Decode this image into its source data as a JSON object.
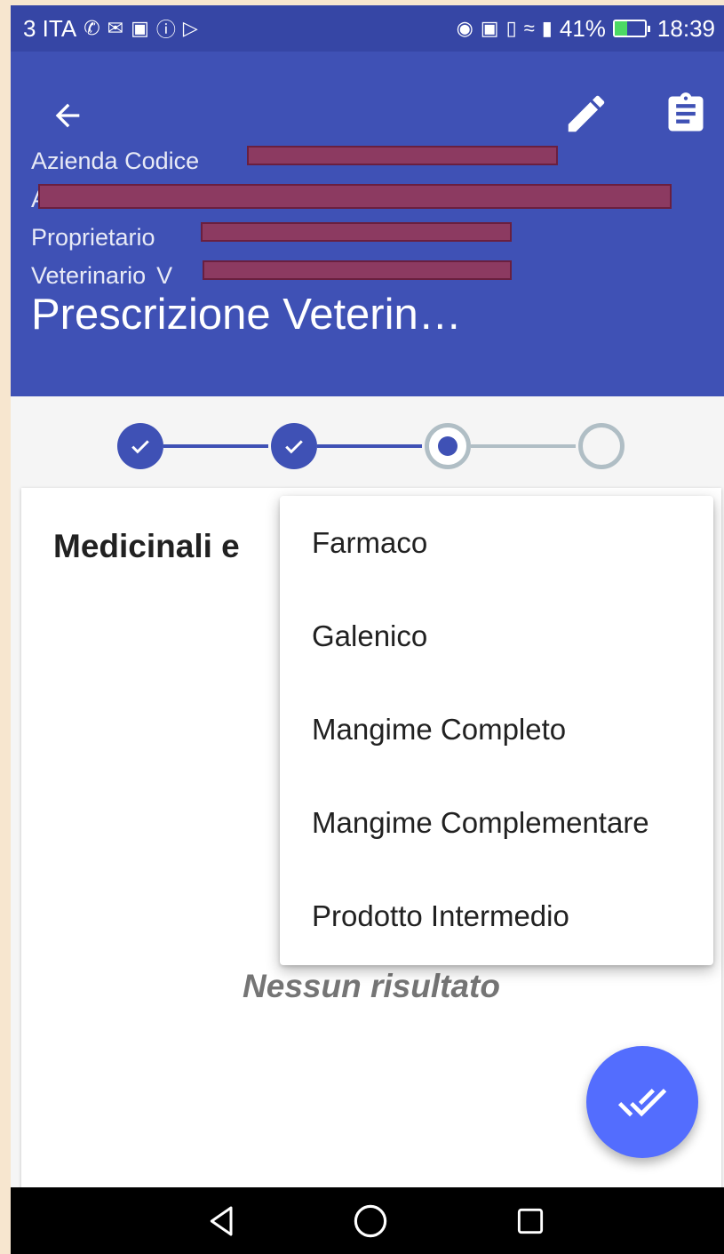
{
  "status_bar": {
    "carrier": "3 ITA",
    "left_icons": [
      "whatsapp-icon",
      "mail-icon",
      "gallery-icon",
      "alert-icon",
      "play-store-icon"
    ],
    "right_icons": [
      "location-icon",
      "nfc-icon",
      "vibrate-icon",
      "wifi-icon",
      "signal-icon"
    ],
    "battery_percent": "41%",
    "battery_level": 0.41,
    "time": "18:39"
  },
  "app_bar": {
    "background_color": "#3f51b5",
    "back_icon": "arrow-back-icon",
    "edit_icon": "pencil-icon",
    "clipboard_icon": "clipboard-icon",
    "info": {
      "azienda_label": "Azienda Codice",
      "second_row_prefix": "A",
      "proprietario_label": "Proprietario",
      "veterinario_label": "Veterinario",
      "veterinario_prefix": "V"
    },
    "title": "Prescrizione Veterin…"
  },
  "stepper": {
    "steps": [
      {
        "state": "completed"
      },
      {
        "state": "completed"
      },
      {
        "state": "current"
      },
      {
        "state": "pending"
      }
    ],
    "active_color": "#3f51b5",
    "inactive_color": "#b0bec5"
  },
  "card": {
    "title": "Medicinali e",
    "empty_text": "Nessun risultato"
  },
  "menu": {
    "items": [
      "Farmaco",
      "Galenico",
      "Mangime Completo",
      "Mangime Complementare",
      "Prodotto Intermedio"
    ]
  },
  "fab": {
    "icon": "done-all-icon",
    "color": "#536dfe"
  },
  "nav_bar": {
    "back_icon": "nav-back-icon",
    "home_icon": "nav-home-icon",
    "recents_icon": "nav-recents-icon"
  }
}
